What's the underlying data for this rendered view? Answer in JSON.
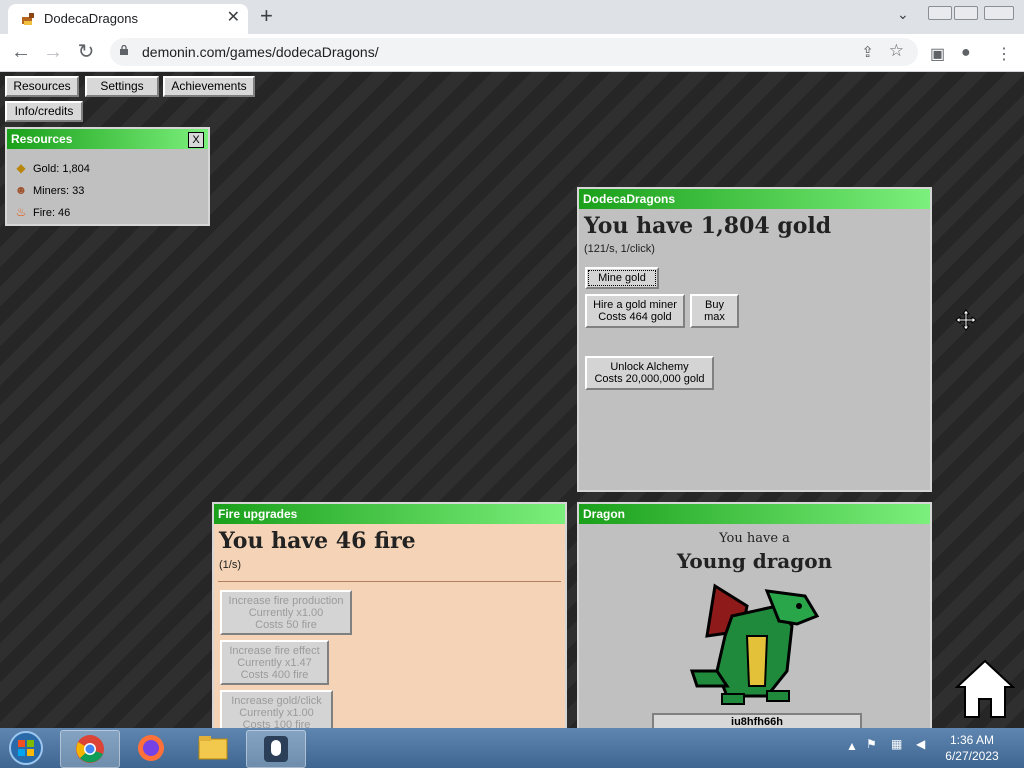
{
  "browser": {
    "tab_title": "DodecaDragons",
    "tab_close": "✕",
    "new_tab": "+",
    "url": "demonin.com/games/dodecaDragons/"
  },
  "nav": {
    "buttons": [
      "Resources",
      "Settings",
      "Achievements",
      "Info/credits"
    ]
  },
  "resources_panel": {
    "title": "Resources",
    "close": "X",
    "items": [
      {
        "label": "Gold: 1,804",
        "icon": "gold-icon"
      },
      {
        "label": "Miners: 33",
        "icon": "miner-icon"
      },
      {
        "label": "Fire: 46",
        "icon": "fire-icon"
      }
    ]
  },
  "main_panel": {
    "title": "DodecaDragons",
    "gold_heading": "You have 1,804 gold",
    "rate": "(121/s, 1/click)",
    "mine_button": "Mine gold",
    "hire_line1": "Hire a gold miner",
    "hire_line2": "Costs 464 gold",
    "buy_line1": "Buy",
    "buy_line2": "max",
    "alchemy_line1": "Unlock Alchemy",
    "alchemy_line2": "Costs 20,000,000 gold"
  },
  "fire_panel": {
    "title": "Fire upgrades",
    "heading": "You have 46 fire",
    "rate": "(1/s)",
    "upgrades": [
      {
        "line1": "Increase fire production",
        "line2": "Currently x1.00",
        "line3": "Costs 50 fire"
      },
      {
        "line1": "Increase fire effect",
        "line2": "Currently x1.47",
        "line3": "Costs 400 fire"
      },
      {
        "line1": "Increase gold/click",
        "line2": "Currently x1.00",
        "line3": "Costs 100 fire"
      }
    ]
  },
  "dragon_panel": {
    "title": "Dragon",
    "line1": "You have a",
    "line2": "Young dragon",
    "name": "iu8hfh66h"
  },
  "taskbar": {
    "time": "1:36 AM",
    "date": "6/27/2023"
  },
  "colors": {
    "panel_header_start": "#1aa01a",
    "panel_header_end": "#7cf07c",
    "fire_panel_bg": "#f4d3b6",
    "panel_bg": "#c0c0c0"
  }
}
